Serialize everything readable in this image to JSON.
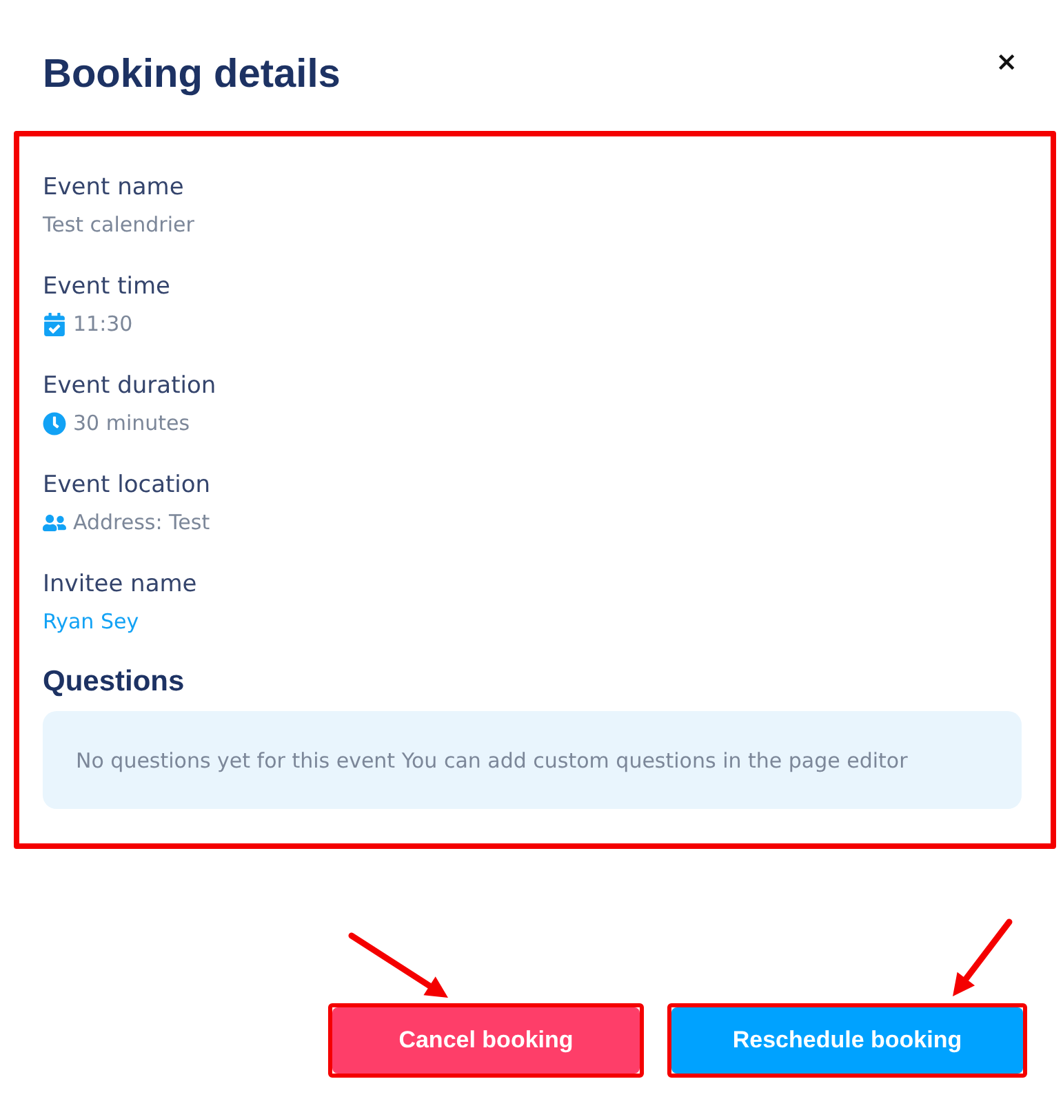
{
  "dialog": {
    "title": "Booking details",
    "close": "×"
  },
  "details": {
    "highlighted": true,
    "fields": [
      {
        "kind": "text",
        "label": "Event name",
        "value": "Test calendrier"
      },
      {
        "kind": "time",
        "label": "Event time",
        "value": "11:30"
      },
      {
        "kind": "duration",
        "label": "Event duration",
        "value": "30 minutes"
      },
      {
        "kind": "location",
        "label": "Event location",
        "value": "Address: Test"
      },
      {
        "kind": "link",
        "label": "Invitee name",
        "value": "Ryan Sey"
      }
    ],
    "questions": {
      "title": "Questions",
      "empty_message": "No questions yet for this event You can add custom questions in the page editor"
    }
  },
  "buttons": [
    {
      "kind": "danger",
      "label": "Cancel booking",
      "highlighted": true,
      "arrow": true
    },
    {
      "kind": "primary",
      "label": "Reschedule booking",
      "highlighted": true,
      "arrow": true
    }
  ]
}
